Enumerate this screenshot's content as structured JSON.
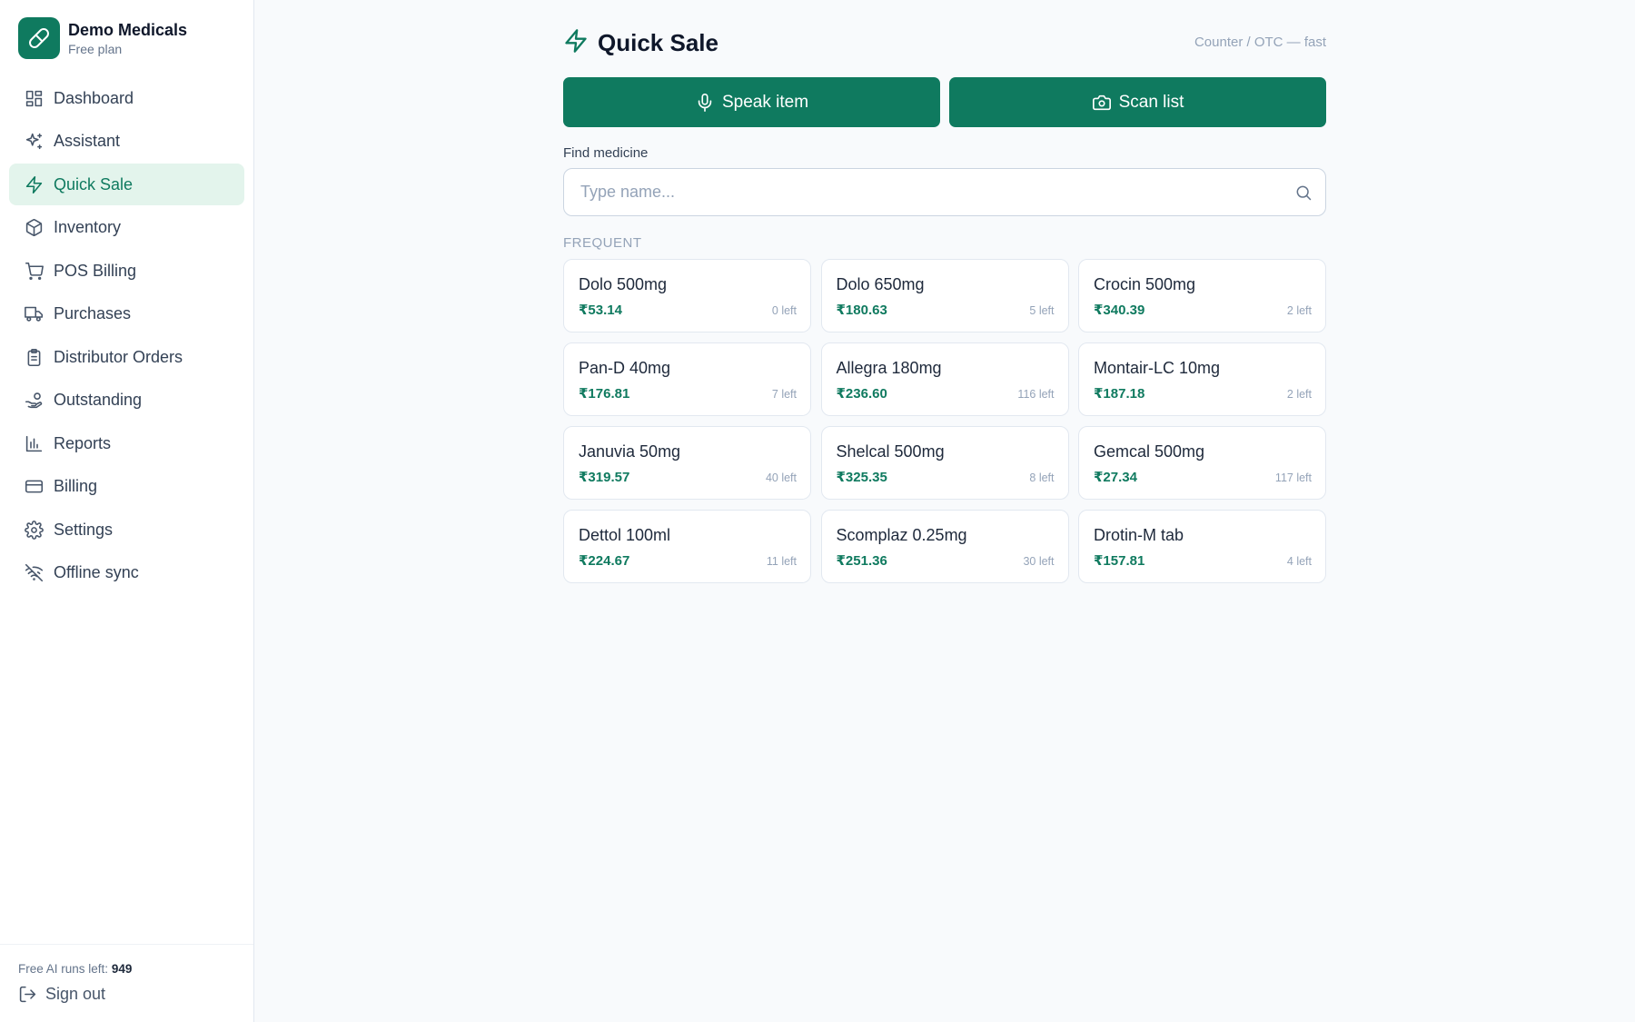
{
  "brand": {
    "name": "Demo Medicals",
    "plan": "Free plan"
  },
  "nav": [
    {
      "label": "Dashboard",
      "icon": "dashboard-icon",
      "active": false
    },
    {
      "label": "Assistant",
      "icon": "sparkles-icon",
      "active": false
    },
    {
      "label": "Quick Sale",
      "icon": "bolt-icon",
      "active": true
    },
    {
      "label": "Inventory",
      "icon": "box-icon",
      "active": false
    },
    {
      "label": "POS Billing",
      "icon": "cart-icon",
      "active": false
    },
    {
      "label": "Purchases",
      "icon": "truck-icon",
      "active": false
    },
    {
      "label": "Distributor Orders",
      "icon": "clipboard-icon",
      "active": false
    },
    {
      "label": "Outstanding",
      "icon": "hand-coins-icon",
      "active": false
    },
    {
      "label": "Reports",
      "icon": "bar-chart-icon",
      "active": false
    },
    {
      "label": "Billing",
      "icon": "credit-card-icon",
      "active": false
    },
    {
      "label": "Settings",
      "icon": "gear-icon",
      "active": false
    },
    {
      "label": "Offline sync",
      "icon": "wifi-off-icon",
      "active": false
    }
  ],
  "footer": {
    "ai_runs_label": "Free AI runs left:",
    "ai_runs_value": "949",
    "signout": "Sign out"
  },
  "header": {
    "title": "Quick Sale",
    "subtitle": "Counter / OTC — fast"
  },
  "actions": {
    "speak": "Speak item",
    "scan": "Scan list"
  },
  "search": {
    "label": "Find medicine",
    "placeholder": "Type name...",
    "value": ""
  },
  "frequent": {
    "label": "FREQUENT",
    "items": [
      {
        "name": "Dolo 500mg",
        "price": "₹53.14",
        "stock": "0 left"
      },
      {
        "name": "Dolo 650mg",
        "price": "₹180.63",
        "stock": "5 left"
      },
      {
        "name": "Crocin 500mg",
        "price": "₹340.39",
        "stock": "2 left"
      },
      {
        "name": "Pan-D 40mg",
        "price": "₹176.81",
        "stock": "7 left"
      },
      {
        "name": "Allegra 180mg",
        "price": "₹236.60",
        "stock": "116 left"
      },
      {
        "name": "Montair-LC 10mg",
        "price": "₹187.18",
        "stock": "2 left"
      },
      {
        "name": "Januvia 50mg",
        "price": "₹319.57",
        "stock": "40 left"
      },
      {
        "name": "Shelcal 500mg",
        "price": "₹325.35",
        "stock": "8 left"
      },
      {
        "name": "Gemcal 500mg",
        "price": "₹27.34",
        "stock": "117 left"
      },
      {
        "name": "Dettol 100ml",
        "price": "₹224.67",
        "stock": "11 left"
      },
      {
        "name": "Scomplaz 0.25mg",
        "price": "₹251.36",
        "stock": "30 left"
      },
      {
        "name": "Drotin-M tab",
        "price": "₹157.81",
        "stock": "4 left"
      }
    ]
  },
  "colors": {
    "accent": "#0f7a5f",
    "active_bg": "#e3f4ec",
    "page_bg": "#f8fafc"
  }
}
